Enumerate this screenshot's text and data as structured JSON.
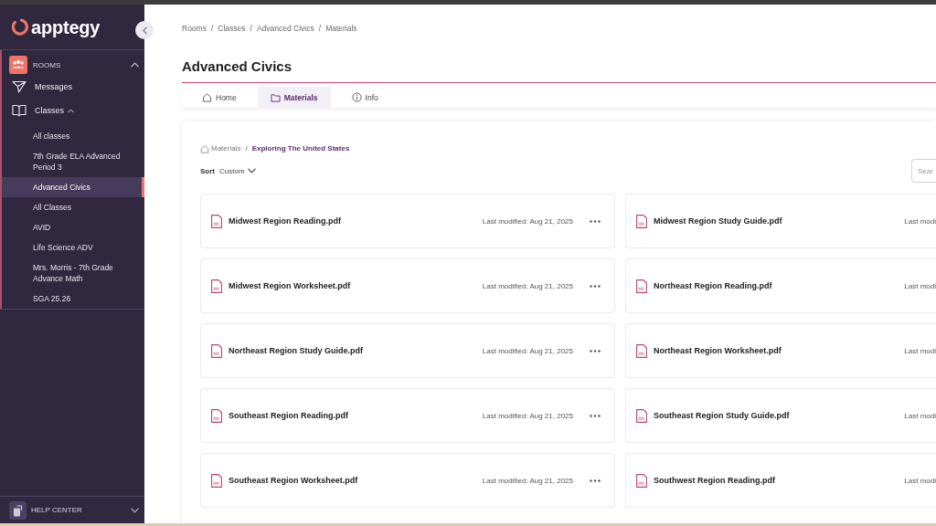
{
  "sidebar": {
    "logo": "apptegy",
    "rooms": {
      "label": "ROOMS",
      "expanded": true
    },
    "nav": [
      {
        "kind": "link",
        "label": "Messages"
      },
      {
        "kind": "group",
        "label": "Classes",
        "expanded": true,
        "children": [
          {
            "label": "All classes",
            "selected": false
          },
          {
            "label": "7th Grade ELA Advanced Period 3",
            "selected": false
          },
          {
            "label": "Advanced Civics",
            "selected": true
          },
          {
            "label": "All Classes",
            "selected": false
          },
          {
            "label": "AVID",
            "selected": false
          },
          {
            "label": "Life Science ADV",
            "selected": false
          },
          {
            "label": "Mrs. Morris - 7th Grade Advance Math",
            "selected": false
          },
          {
            "label": "SGA 25.26",
            "selected": false
          }
        ]
      }
    ],
    "help": {
      "label": "HELP CENTER",
      "expanded": false
    }
  },
  "breadcrumb": [
    {
      "label": "Rooms",
      "separator": "/"
    },
    {
      "label": "Classes",
      "separator": "/"
    },
    {
      "label": "Advanced Civics",
      "separator": "/"
    },
    {
      "label": "Materials"
    }
  ],
  "page_title": "Advanced Civics",
  "tabs": [
    {
      "label": "Home",
      "selected": false
    },
    {
      "label": "Materials",
      "selected": true
    },
    {
      "label": "Info",
      "selected": false
    }
  ],
  "materials": {
    "breadcrumb": [
      {
        "label": "Materials",
        "separator": "/"
      },
      {
        "label": "Exploring The United States"
      }
    ],
    "sort": {
      "label": "Sort",
      "value": "Custom"
    },
    "search": {
      "placeholder": "Sear"
    },
    "files": [
      {
        "name": "Midwest Region Reading.pdf",
        "modified": "Last modified: Aug 21, 2025"
      },
      {
        "name": "Midwest Region Study Guide.pdf",
        "modified": "Last modi"
      },
      {
        "name": "Midwest Region Worksheet.pdf",
        "modified": "Last modified: Aug 21, 2025"
      },
      {
        "name": "Northeast Region Reading.pdf",
        "modified": "Last modi"
      },
      {
        "name": "Northeast Region Study Guide.pdf",
        "modified": "Last modified: Aug 21, 2025"
      },
      {
        "name": "Northeast Region Worksheet.pdf",
        "modified": "Last modi"
      },
      {
        "name": "Southeast Region Reading.pdf",
        "modified": "Last modified: Aug 21, 2025"
      },
      {
        "name": "Southeast Region Study Guide.pdf",
        "modified": "Last modi"
      },
      {
        "name": "Southeast Region Worksheet.pdf",
        "modified": "Last modified: Aug 21, 2025"
      },
      {
        "name": "Southwest Region Reading.pdf",
        "modified": "Last modi"
      }
    ]
  }
}
